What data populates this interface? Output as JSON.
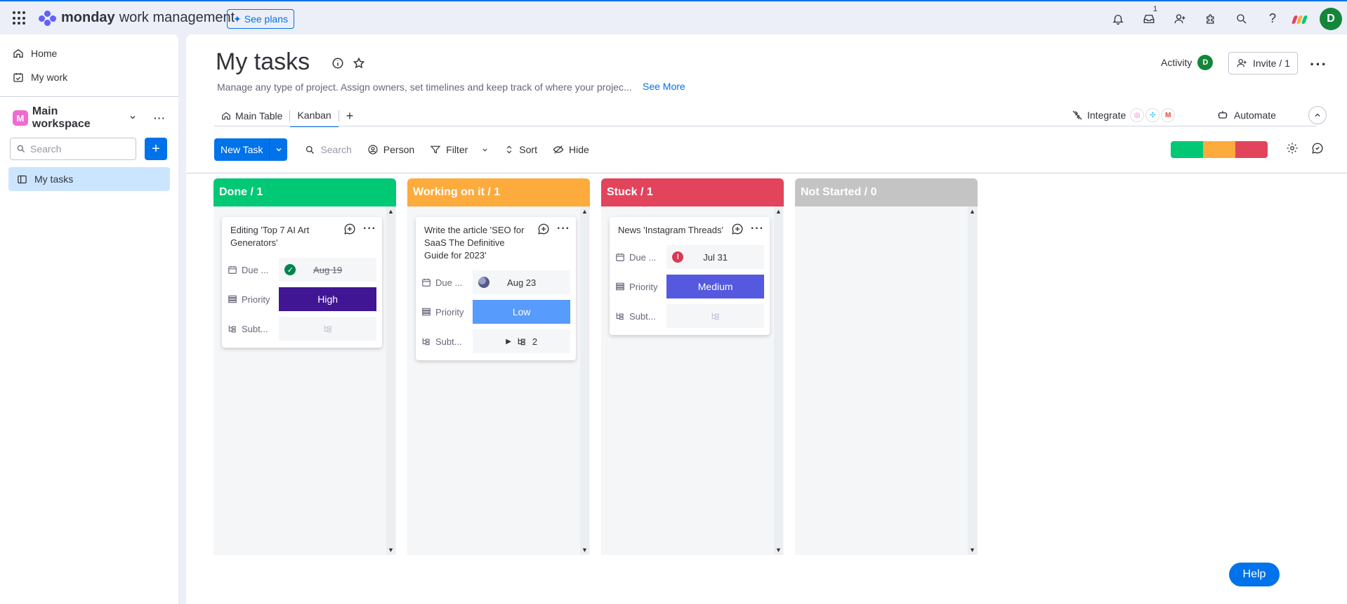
{
  "topbar": {
    "brand_bold": "monday",
    "brand_rest": "work management",
    "see_plans": "See plans",
    "inbox_badge": "1",
    "user_initial": "D"
  },
  "sidebar": {
    "home": "Home",
    "my_work": "My work",
    "workspace_initial": "M",
    "workspace_name": "Main workspace",
    "search_placeholder": "Search",
    "boards": [
      {
        "label": "My tasks"
      }
    ]
  },
  "board": {
    "title": "My tasks",
    "description": "Manage any type of project. Assign owners, set timelines and keep track of where your projec...",
    "see_more": "See More",
    "activity": "Activity",
    "activity_initial": "D",
    "invite": "Invite / 1",
    "tabs": [
      {
        "label": "Main Table"
      },
      {
        "label": "Kanban"
      }
    ],
    "integrate": "Integrate",
    "automate": "Automate"
  },
  "toolbar": {
    "new_task": "New Task",
    "search": "Search",
    "person": "Person",
    "filter": "Filter",
    "sort": "Sort",
    "hide": "Hide"
  },
  "colors": {
    "done": "#00c875",
    "working": "#fdab3d",
    "stuck": "#e2445c",
    "not_started": "#c4c4c4",
    "high": "#401694",
    "low": "#579bfc",
    "medium": "#5559df",
    "accent": "#0073ea"
  },
  "kanban": {
    "columns": [
      {
        "header": "Done / 1",
        "card": {
          "title": "Editing 'Top 7 AI Art Generators'",
          "due_label": "Due ...",
          "due_value": "Aug 19",
          "priority_label": "Priority",
          "priority_value": "High",
          "subtasks_label": "Subt...",
          "subtasks_value": ""
        }
      },
      {
        "header": "Working on it / 1",
        "card": {
          "title": "Write the article 'SEO for SaaS The Definitive Guide for 2023'",
          "due_label": "Due ...",
          "due_value": "Aug 23",
          "priority_label": "Priority",
          "priority_value": "Low",
          "subtasks_label": "Subt...",
          "subtasks_value": "2"
        }
      },
      {
        "header": "Stuck / 1",
        "card": {
          "title": "News 'Instagram Threads'",
          "due_label": "Due ...",
          "due_value": "Jul 31",
          "priority_label": "Priority",
          "priority_value": "Medium",
          "subtasks_label": "Subt...",
          "subtasks_value": ""
        }
      },
      {
        "header": "Not Started / 0"
      }
    ]
  },
  "help": "Help"
}
